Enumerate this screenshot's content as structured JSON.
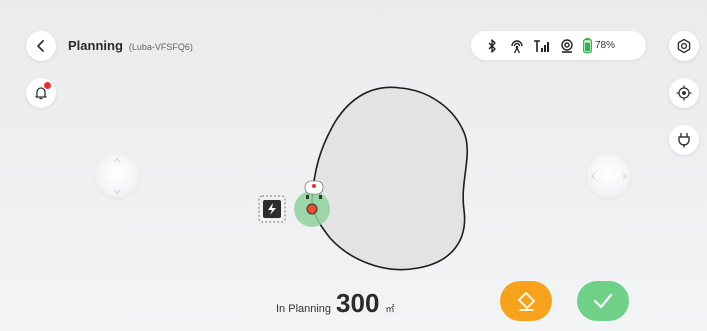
{
  "header": {
    "title": "Planning",
    "device_name": "(Luba-VFSFQ6)"
  },
  "status_bar": {
    "icons": [
      "bluetooth-icon",
      "rtk-signal-icon",
      "cellular-signal-icon",
      "camera-icon",
      "battery-icon"
    ],
    "battery_percent": "78%"
  },
  "notifications": {
    "has_unread": true
  },
  "planning": {
    "label": "In Planning",
    "area_value": "300",
    "area_unit": "㎡"
  },
  "colors": {
    "orange": "#f7a21b",
    "green": "#6fd188",
    "notification_dot": "#e5322d",
    "battery": "#2fb44a"
  }
}
